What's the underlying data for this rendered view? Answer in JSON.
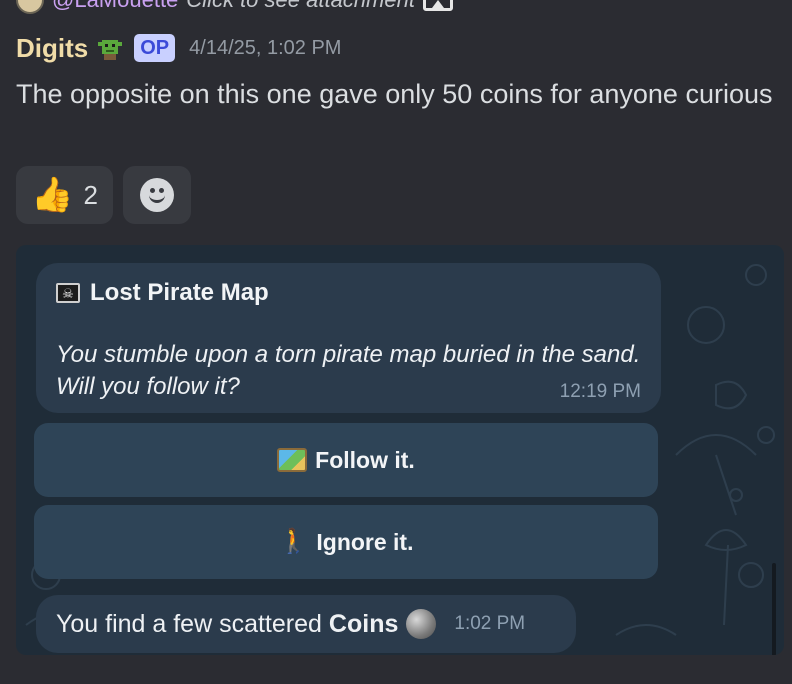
{
  "reply": {
    "mention": "@LaMouette",
    "text": "Click to see attachment",
    "avatar_icon": "avatar",
    "image_icon": "image-icon"
  },
  "message": {
    "author": "Digits",
    "author_icon": "goblin-icon",
    "badge": "OP",
    "timestamp": "4/14/25, 1:02 PM",
    "text": "The opposite on this one gave only 50 coins for anyone curious"
  },
  "reactions": [
    {
      "emoji_icon": "thumbs-up-icon",
      "count": "2"
    },
    {
      "icon": "add-reaction-icon"
    }
  ],
  "attachment": {
    "game_message": {
      "title": "Lost Pirate Map",
      "title_icon": "pirate-flag-icon",
      "body": "You stumble upon a torn pirate map buried in the sand. Will you follow it?",
      "time": "12:19 PM"
    },
    "buttons": [
      {
        "label": "Follow it.",
        "icon": "map-icon"
      },
      {
        "label": "Ignore it.",
        "icon": "walking-person-icon"
      }
    ],
    "result_message": {
      "text": "You find a few scattered",
      "bold": "Coins",
      "icon": "coin-icon",
      "time": "1:02 PM"
    }
  },
  "colors": {
    "background": "#2b2c32",
    "author": "#f0dca8",
    "bubble": "#2b3b4c",
    "button": "#2e4457",
    "chat_background": "#1f2c38"
  }
}
